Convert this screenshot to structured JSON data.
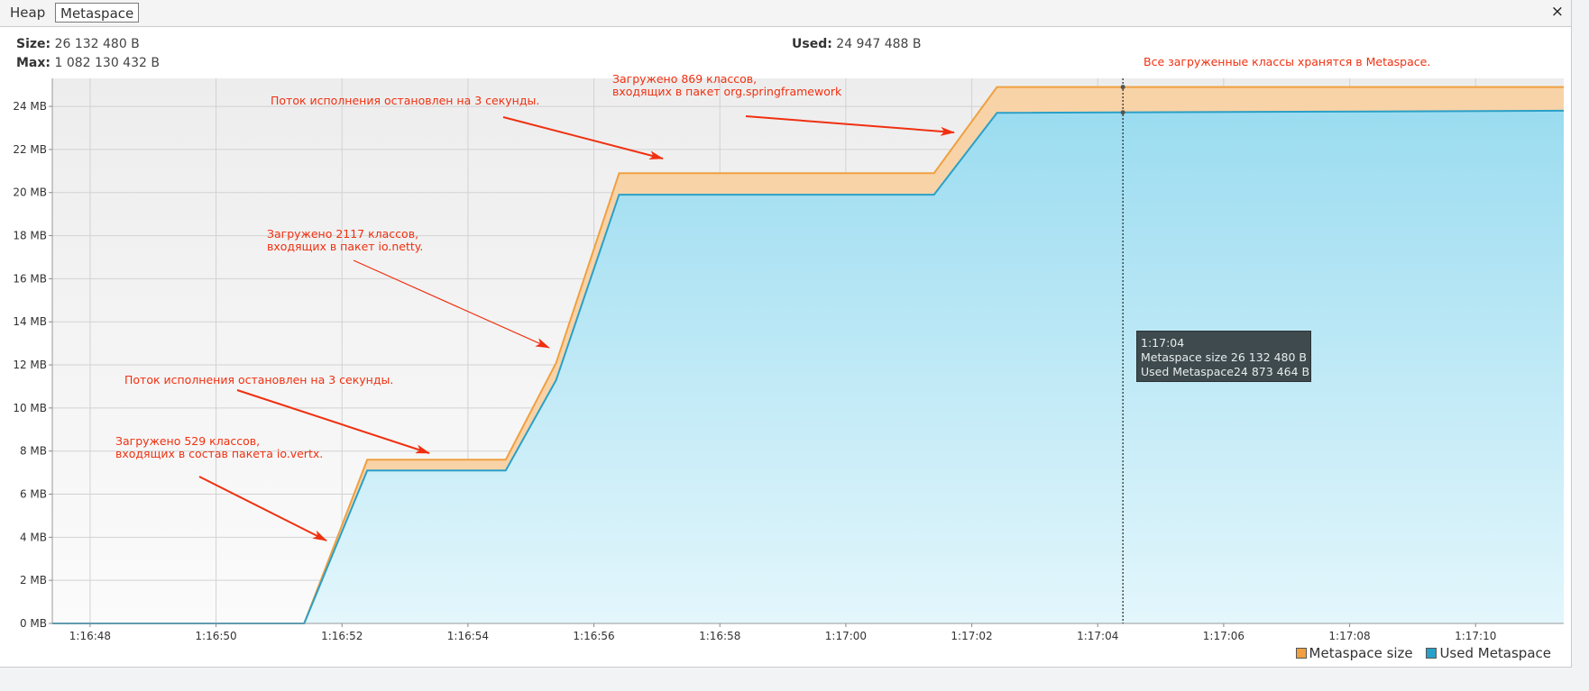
{
  "tabs": [
    {
      "label": "Heap"
    },
    {
      "label": "Metaspace"
    }
  ],
  "close_icon": "×",
  "stats": {
    "size_label": "Size:",
    "size_value": "26 132 480 B",
    "max_label": "Max:",
    "max_value": "1 082 130 432 B",
    "used_label": "Used:",
    "used_value": "24 947 488 B"
  },
  "tooltip": {
    "time": "1:17:04",
    "rows": [
      {
        "name": "Metaspace size",
        "value": "26 132 480 B"
      },
      {
        "name": "Used Metaspace",
        "value": "24 873 464 B"
      }
    ]
  },
  "annotations": [
    {
      "lines": [
        "Все загруженные классы хранятся в Metaspace."
      ]
    },
    {
      "lines": [
        "Загружено 869 классов,",
        "входящих в пакет org.springframework"
      ]
    },
    {
      "lines": [
        "Поток исполнения остановлен на 3 секунды."
      ]
    },
    {
      "lines": [
        "Загружено 2117 классов,",
        "входящих в пакет io.netty."
      ]
    },
    {
      "lines": [
        "Поток исполнения остановлен на 3 секунды."
      ]
    },
    {
      "lines": [
        "Загружено 529 классов,",
        "входящих в состав пакета io.vertx."
      ]
    }
  ],
  "colors": {
    "size": "#f0a040",
    "used": "#2aa0c8",
    "annotation": "#f03010"
  },
  "chart_data": {
    "type": "area",
    "x_ticks": [
      "1:16:48",
      "1:16:50",
      "1:16:52",
      "1:16:54",
      "1:16:56",
      "1:16:58",
      "1:17:00",
      "1:17:02",
      "1:17:04",
      "1:17:06",
      "1:17:08",
      "1:17:10"
    ],
    "y_ticks": [
      "0 MB",
      "2 MB",
      "4 MB",
      "6 MB",
      "8 MB",
      "10 MB",
      "12 MB",
      "14 MB",
      "16 MB",
      "18 MB",
      "20 MB",
      "22 MB",
      "24 MB"
    ],
    "ylim": [
      0,
      25.3
    ],
    "xlim": [
      -0.6,
      23.4
    ],
    "x": [
      -0.6,
      3.4,
      4.4,
      6.6,
      7.4,
      8.4,
      13.4,
      14.4,
      23.4
    ],
    "series": [
      {
        "name": "Metaspace size",
        "values": [
          0,
          0,
          7.6,
          7.6,
          12.1,
          20.9,
          20.9,
          24.9,
          24.9
        ]
      },
      {
        "name": "Used Metaspace",
        "values": [
          0,
          0,
          7.1,
          7.1,
          11.3,
          19.9,
          19.9,
          23.7,
          23.8
        ]
      }
    ],
    "cursor_x": 16.4,
    "legend": [
      {
        "name": "Metaspace size"
      },
      {
        "name": "Used Metaspace"
      }
    ],
    "legend_position": "bottom-right",
    "grid": true
  }
}
